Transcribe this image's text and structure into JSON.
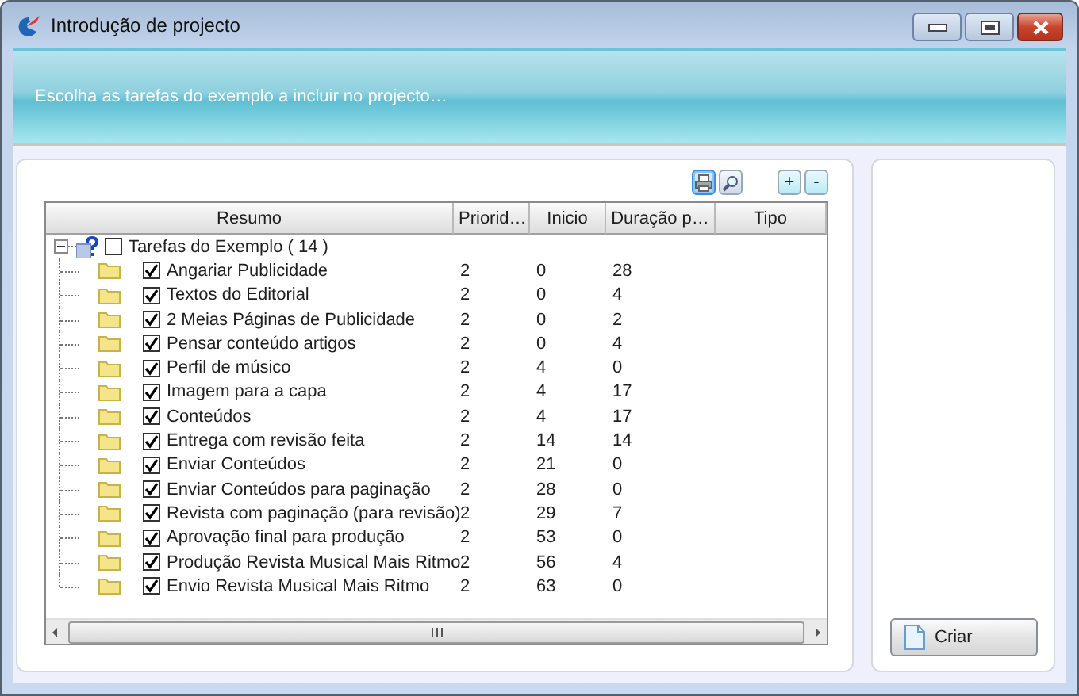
{
  "window": {
    "title": "Introdução de projecto"
  },
  "banner": {
    "text": "Escolha as tarefas do exemplo a incluir no projecto…"
  },
  "toolbar": {
    "buttons": [
      {
        "kind": "print",
        "pressed": true
      },
      {
        "kind": "preview",
        "pressed": false
      },
      {
        "kind": "add",
        "label": "+"
      },
      {
        "kind": "remove",
        "label": "-"
      }
    ]
  },
  "table": {
    "columns": [
      "Resumo",
      "Priorid…",
      "Inicio",
      "Duração p…",
      "Tipo"
    ],
    "root": {
      "label": "Tarefas do Exemplo ( 14 )",
      "expanded": true,
      "checked": false,
      "children": [
        {
          "name": "Angariar Publicidade",
          "checked": true,
          "priority": "2",
          "start": "0",
          "duration": "28"
        },
        {
          "name": "Textos do Editorial",
          "checked": true,
          "priority": "2",
          "start": "0",
          "duration": "4"
        },
        {
          "name": "2 Meias Páginas de Publicidade",
          "checked": true,
          "priority": "2",
          "start": "0",
          "duration": "2"
        },
        {
          "name": "Pensar conteúdo artigos",
          "checked": true,
          "priority": "2",
          "start": "0",
          "duration": "4"
        },
        {
          "name": "Perfil de músico",
          "checked": true,
          "priority": "2",
          "start": "4",
          "duration": "0"
        },
        {
          "name": "Imagem para a capa",
          "checked": true,
          "priority": "2",
          "start": "4",
          "duration": "17"
        },
        {
          "name": "Conteúdos",
          "checked": true,
          "priority": "2",
          "start": "4",
          "duration": "17"
        },
        {
          "name": "Entrega com revisão feita",
          "checked": true,
          "priority": "2",
          "start": "14",
          "duration": "14"
        },
        {
          "name": "Enviar Conteúdos",
          "checked": true,
          "priority": "2",
          "start": "21",
          "duration": "0"
        },
        {
          "name": "Enviar Conteúdos para paginação",
          "checked": true,
          "priority": "2",
          "start": "28",
          "duration": "0"
        },
        {
          "name": "Revista com paginação (para revisão)",
          "checked": true,
          "priority": "2",
          "start": "29",
          "duration": "7"
        },
        {
          "name": "Aprovação final para produção",
          "checked": true,
          "priority": "2",
          "start": "53",
          "duration": "0"
        },
        {
          "name": "Produção Revista Musical Mais Ritmo",
          "checked": true,
          "priority": "2",
          "start": "56",
          "duration": "4"
        },
        {
          "name": "Envio Revista Musical Mais Ritmo",
          "checked": true,
          "priority": "2",
          "start": "63",
          "duration": "0"
        }
      ]
    }
  },
  "create_button": {
    "label": "Criar"
  }
}
